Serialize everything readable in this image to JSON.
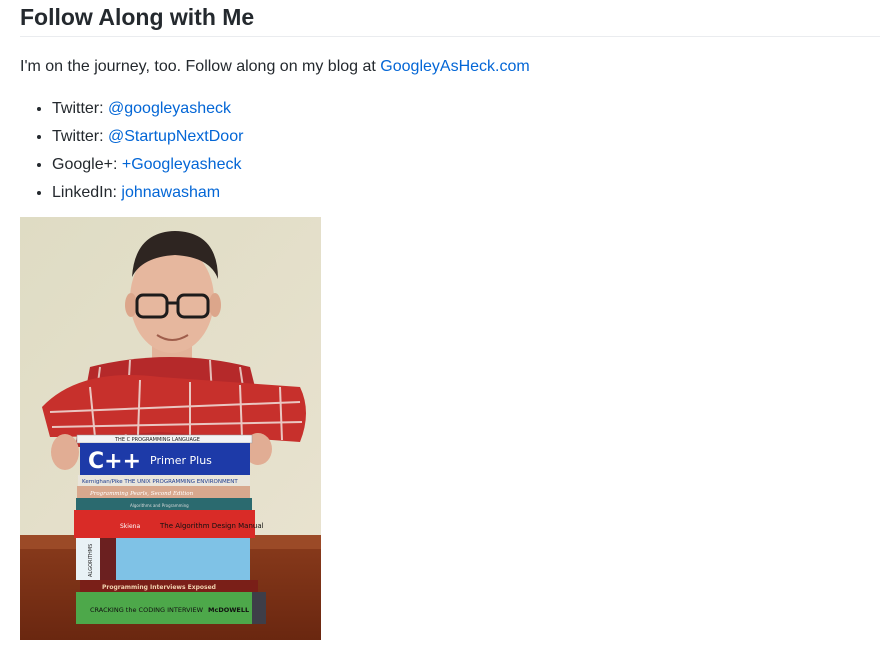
{
  "section": {
    "title": "Follow Along with Me"
  },
  "intro": {
    "text": "I'm on the journey, too. Follow along on my blog at",
    "link_text": "GoogleyAsHeck.com"
  },
  "links": [
    {
      "label": "Twitter:",
      "value": "@googleyasheck"
    },
    {
      "label": "Twitter:",
      "value": "@StartupNextDoor"
    },
    {
      "label": "Google+:",
      "value": "+Googleyasheck"
    },
    {
      "label": "LinkedIn:",
      "value": "johnawasham"
    }
  ],
  "photo": {
    "books": [
      {
        "title": "THE C PROGRAMMING LANGUAGE",
        "color": "#f3f3f3"
      },
      {
        "title": "C++",
        "subtitle": "Primer Plus",
        "color": "#1d3aa8"
      },
      {
        "title": "Kernighan/Pike  THE UNIX PROGRAMMING ENVIRONMENT",
        "color": "#e9e5dc"
      },
      {
        "title": "Programming Pearls, Second Edition",
        "color": "#d8a88e"
      },
      {
        "title": "Algorithms and Programming",
        "color": "#2b6a6f"
      },
      {
        "title": "The Algorithm Design Manual",
        "author": "Skiena",
        "color": "#d92b27"
      },
      {
        "title": "ALGORITHMS",
        "color": "#7fc2e6"
      },
      {
        "title": "Programming Interviews Exposed",
        "color": "#7a1f18"
      },
      {
        "title": "CRACKING the CODING INTERVIEW",
        "author": "McDOWELL",
        "color": "#4da84a"
      }
    ]
  }
}
